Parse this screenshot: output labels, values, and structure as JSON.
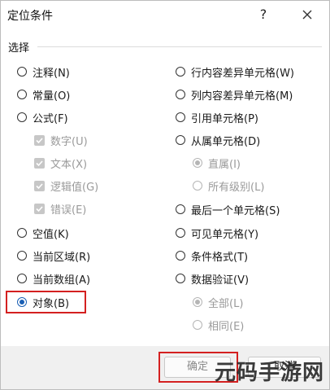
{
  "dialog": {
    "title": "定位条件",
    "help": "?",
    "section": "选择"
  },
  "left_options": [
    {
      "label": "注释(N)",
      "type": "radio",
      "checked": false,
      "disabled": false
    },
    {
      "label": "常量(O)",
      "type": "radio",
      "checked": false,
      "disabled": false
    },
    {
      "label": "公式(F)",
      "type": "radio",
      "checked": false,
      "disabled": false
    },
    {
      "label": "数字(U)",
      "type": "checkbox",
      "checked": true,
      "disabled": true
    },
    {
      "label": "文本(X)",
      "type": "checkbox",
      "checked": true,
      "disabled": true
    },
    {
      "label": "逻辑值(G)",
      "type": "checkbox",
      "checked": true,
      "disabled": true
    },
    {
      "label": "错误(E)",
      "type": "checkbox",
      "checked": true,
      "disabled": true
    },
    {
      "label": "空值(K)",
      "type": "radio",
      "checked": false,
      "disabled": false
    },
    {
      "label": "当前区域(R)",
      "type": "radio",
      "checked": false,
      "disabled": false
    },
    {
      "label": "当前数组(A)",
      "type": "radio",
      "checked": false,
      "disabled": false
    },
    {
      "label": "对象(B)",
      "type": "radio",
      "checked": true,
      "disabled": false
    }
  ],
  "right_options": [
    {
      "label": "行内容差异单元格(W)",
      "type": "radio",
      "checked": false,
      "disabled": false
    },
    {
      "label": "列内容差异单元格(M)",
      "type": "radio",
      "checked": false,
      "disabled": false
    },
    {
      "label": "引用单元格(P)",
      "type": "radio",
      "checked": false,
      "disabled": false
    },
    {
      "label": "从属单元格(D)",
      "type": "radio",
      "checked": false,
      "disabled": false
    },
    {
      "label": "直属(I)",
      "type": "radio",
      "checked": true,
      "disabled": true
    },
    {
      "label": "所有级别(L)",
      "type": "radio",
      "checked": false,
      "disabled": true
    },
    {
      "label": "最后一个单元格(S)",
      "type": "radio",
      "checked": false,
      "disabled": false
    },
    {
      "label": "可见单元格(Y)",
      "type": "radio",
      "checked": false,
      "disabled": false
    },
    {
      "label": "条件格式(T)",
      "type": "radio",
      "checked": false,
      "disabled": false
    },
    {
      "label": "数据验证(V)",
      "type": "radio",
      "checked": false,
      "disabled": false
    },
    {
      "label": "全部(L)",
      "type": "radio",
      "checked": true,
      "disabled": true
    },
    {
      "label": "相同(E)",
      "type": "radio",
      "checked": false,
      "disabled": true
    }
  ],
  "buttons": {
    "ok": "确定",
    "cancel": "取消"
  },
  "watermark": "元码手游网",
  "colors": {
    "accent": "#1a5fb4",
    "highlight": "#d42020"
  }
}
